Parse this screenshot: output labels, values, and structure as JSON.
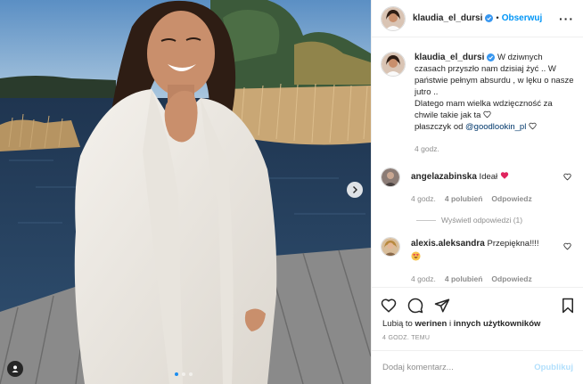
{
  "header": {
    "username": "klaudia_el_dursi",
    "separator": "•",
    "follow_label": "Obserwuj",
    "more_label": "···"
  },
  "caption": {
    "username": "klaudia_el_dursi",
    "text1": " W dziwnych czasach przyszło nam dzisiaj żyć .. W państwie pełnym absurdu , w lęku o nasze jutro ..",
    "text2": "Dlatego mam wielka wdzięczność za chwile takie jak ta ",
    "text3": "płaszczyk od ",
    "mention": "@goodlookin_pl",
    "time": "4 godz."
  },
  "comments": [
    {
      "username": "angelazabinska",
      "text": " Ideał ",
      "time": "4 godz.",
      "likes": "4 polubień",
      "reply": "Odpowiedz",
      "view_replies": "Wyświetl odpowiedzi (1)"
    },
    {
      "username": "alexis.aleksandra",
      "text": " Przepiękna!!!!",
      "time": "4 godz.",
      "likes": "4 polubień",
      "reply": "Odpowiedz"
    }
  ],
  "likes": {
    "prefix": "Lubią to ",
    "user": "werinen",
    "middle": " i ",
    "others": "innych użytkowników"
  },
  "timestamp": "4 GODZ. TEMU",
  "add_comment": {
    "placeholder": "Dodaj komentarz...",
    "post_label": "Opublikuj"
  },
  "photo": {
    "slides_total": 3,
    "active_slide": 1
  },
  "colors": {
    "link_blue": "#0095f6",
    "verified_blue": "#3897f0",
    "heart_red": "#ed4956",
    "muted_text": "#8e8e8e"
  },
  "icons": [
    "verified-icon",
    "heart-icon",
    "comment-icon",
    "share-icon",
    "bookmark-icon",
    "chevron-right-icon",
    "user-tag-icon"
  ]
}
